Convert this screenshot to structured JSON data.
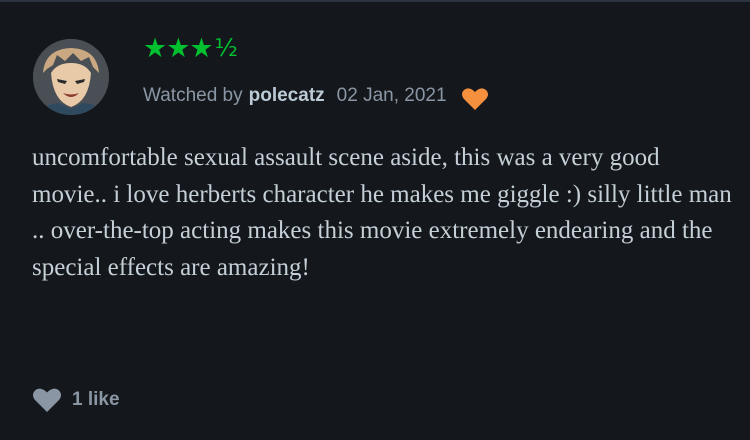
{
  "review": {
    "rating": {
      "stars_text": "★★★",
      "half_text": "½",
      "value": 3.5,
      "max": 5,
      "color": "#00c030"
    },
    "watched_prefix": "Watched by",
    "username": "polecatz",
    "date": "02 Jan, 2021",
    "liked_by_author": true,
    "liked_heart_color": "#f5913e",
    "body": "uncomfortable sexual assault scene aside, this was a very good movie.. i love herberts character he makes me giggle :) silly little man .. over-the-top acting makes this movie extremely endearing and the special effects are amazing!",
    "likes_label": "1 like",
    "likes_count": 1,
    "avatar_icon": "anime-character-avatar",
    "like_icon": "heart-icon"
  },
  "colors": {
    "background": "#14181c",
    "text": "#c5cfd8",
    "muted": "#8b96a4"
  }
}
